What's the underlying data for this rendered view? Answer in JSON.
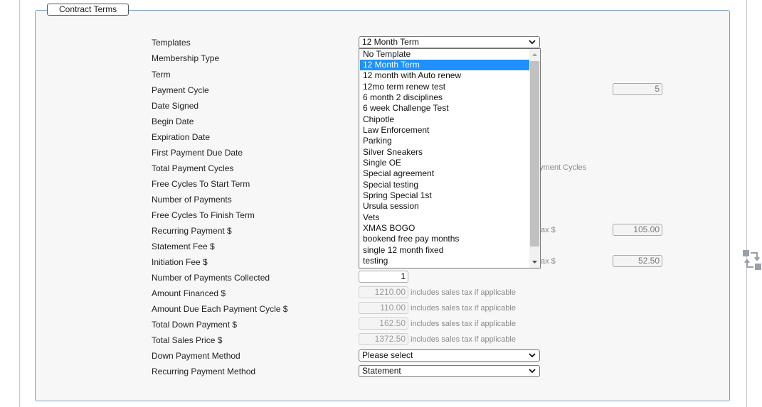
{
  "section": {
    "legend": "Contract Terms"
  },
  "labels": [
    "Templates",
    "Membership Type",
    "Term",
    "Payment Cycle",
    "Date Signed",
    "Begin Date",
    "Expiration Date",
    "First Payment Due Date",
    "Total Payment Cycles",
    "Free Cycles To Start Term",
    "Number of Payments",
    "Free Cycles To Finish Term",
    "Recurring Payment $",
    "Statement Fee $",
    "Initiation Fee $",
    "Number of Payments Collected",
    "Amount Financed $",
    "Amount Due Each Payment Cycle $",
    "Total Down Payment $",
    "Total Sales Price $",
    "Down Payment Method",
    "Recurring Payment Method"
  ],
  "templates_select": {
    "value": "12 Month Term",
    "options": [
      "No Template",
      "12 Month Term",
      "12 month with Auto renew",
      "12mo term renew test",
      "6 month 2 disciplines",
      "6 week Challenge Test",
      "Chipotle",
      "Law Enforcement",
      "Parking",
      "Silver Sneakers",
      "Single OE",
      "Special agreement",
      "Special testing",
      "Spring Special 1st",
      "Ursula session",
      "Vets",
      "XMAS BOGO",
      "bookend free pay months",
      "single 12 month fixed",
      "testing"
    ],
    "selected_index": 1
  },
  "fields": {
    "payments_collected": "1",
    "amount_financed": "1210.00",
    "amount_due_each_cycle": "110.00",
    "total_down_payment": "162.50",
    "total_sales_price": "1372.50",
    "tax_note": "includes sales tax if applicable",
    "down_payment_method": "Please select",
    "recurring_payment_method": "Statement"
  },
  "right_column": {
    "payment_cycle_count": "5",
    "recurring_with_tax": "105.00",
    "initiation_with_tax": "52.50",
    "peek_payment_cycles": "ayment Cycles",
    "peek_tax_1": "ax $",
    "peek_tax_2": "ax $"
  },
  "icons": {
    "chevron": "chevron-down-icon",
    "side": "workflow-icon"
  }
}
